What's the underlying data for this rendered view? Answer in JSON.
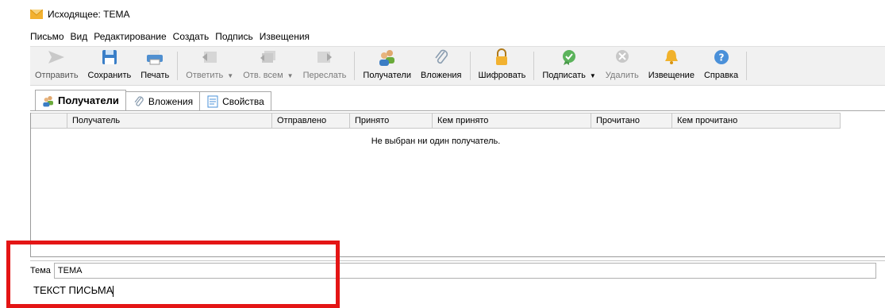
{
  "window": {
    "title": "Исходящее: ТЕМА",
    "icon": "envelope-icon"
  },
  "menu": [
    "Письмо",
    "Вид",
    "Редактирование",
    "Создать",
    "Подпись",
    "Извещения"
  ],
  "toolbar": {
    "send": "Отправить",
    "save": "Сохранить",
    "print": "Печать",
    "reply": "Ответить",
    "reply_all": "Отв. всем",
    "forward": "Переслать",
    "recipients": "Получатели",
    "attachments": "Вложения",
    "encrypt": "Шифровать",
    "sign": "Подписать",
    "delete": "Удалить",
    "notice": "Извещение",
    "help": "Справка"
  },
  "tabs": [
    "Получатели",
    "Вложения",
    "Свойства"
  ],
  "grid": {
    "columns": [
      "Получатель",
      "Отправлено",
      "Принято",
      "Кем принято",
      "Прочитано",
      "Кем прочитано"
    ],
    "empty_message": "Не выбран ни один получатель."
  },
  "subject": {
    "label": "Тема",
    "value": "ТЕМА"
  },
  "body": {
    "text": "ТЕКСТ ПИСЬМА"
  },
  "colors": {
    "highlight": "#e41515",
    "toolbar_bg": "#f1f1f1",
    "blue_icon": "#4a90d9"
  }
}
